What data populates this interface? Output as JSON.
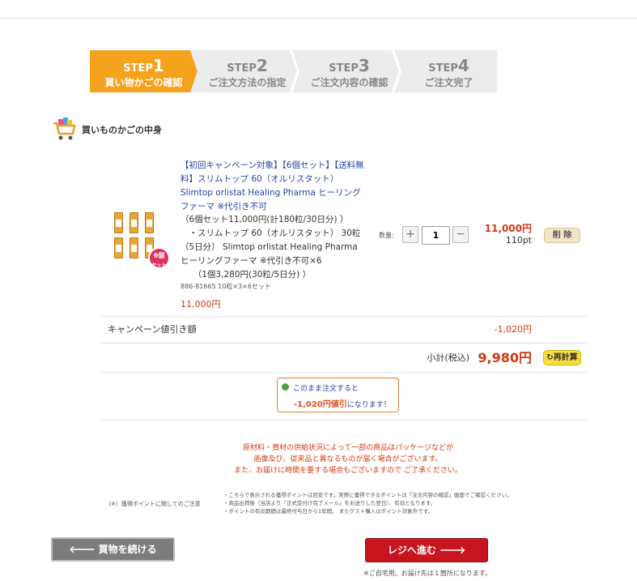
{
  "steps": [
    {
      "step": "STEP",
      "num": "1",
      "label": "買い物かごの確認",
      "active": true
    },
    {
      "step": "STEP",
      "num": "2",
      "label": "ご注文方法の指定",
      "active": false
    },
    {
      "step": "STEP",
      "num": "3",
      "label": "ご注文内容の確認",
      "active": false
    },
    {
      "step": "STEP",
      "num": "4",
      "label": "ご注文完了",
      "active": false
    }
  ],
  "cart": {
    "title": "買いものかごの中身"
  },
  "product": {
    "name": "【初回キャンペーン対象】【6個セット】【送料無料】スリムトップ 60（オルリスタット） Slimtop orlistat Healing Pharma ヒーリングファーマ ※代引き不可",
    "desc_lines": [
      "（6個セット11,000円(計180粒/30日分) ）",
      "　・スリムトップ 60（オルリスタット） 30粒（5日分） Slimtop orlistat Healing Pharma ヒーリングファーマ ※代引き不可×6",
      "　　（1個3,280円(30粒/5日分) ）"
    ],
    "code": "886-81665 10粒×3×6セット",
    "price": "11,000円",
    "badge_line1": "6個",
    "badge_line2": "セット",
    "qty_label": "数量:",
    "qty_value": "1",
    "plus": "+",
    "minus": "−",
    "line_price": "11,000円",
    "points": "110pt",
    "delete_label": "削 除"
  },
  "campaign": {
    "label": "キャンペーン値引き額",
    "value": "-1,020円"
  },
  "subtotal": {
    "label": "小計(税込)",
    "value": "9,980円",
    "recalc_label": "再計算"
  },
  "savings": {
    "line1": "このまま注文すると",
    "amount": "-1,020円値引",
    "suffix": "になります！"
  },
  "notice_lines": [
    "原材料・資材の供給状況によって一部の商品はパッケージなどが",
    "画像及び、従来品と異なるものが届く場合がございます。",
    "また、お届けに時間を要する場合もございますので ご了承ください。"
  ],
  "points_note": {
    "label": "（※）獲得ポイントに関してのご注意",
    "lines": [
      "・こちらで表示される獲得ポイントは目安です。実際に獲得できるポイントは「注文内容の確認」画面でご確認ください。",
      "・商品出荷後（当店より「正式受付け完了メール」をお送りした翌日）、有効となります。",
      "・ポイントの有効期間は最終付与日から1年間。 またゲスト購入はポイント対象外です。"
    ]
  },
  "buttons": {
    "back": "買物を続ける",
    "checkout": "レジへ進む"
  },
  "bottom_note": "※ご自宅用。お届け先は１箇所になります。",
  "colors": {
    "accent": "#f5a21c",
    "price_red": "#d23a12",
    "link_blue": "#2245a6",
    "checkout_red": "#c8141e",
    "recalc_yellow": "#f5de3c"
  }
}
